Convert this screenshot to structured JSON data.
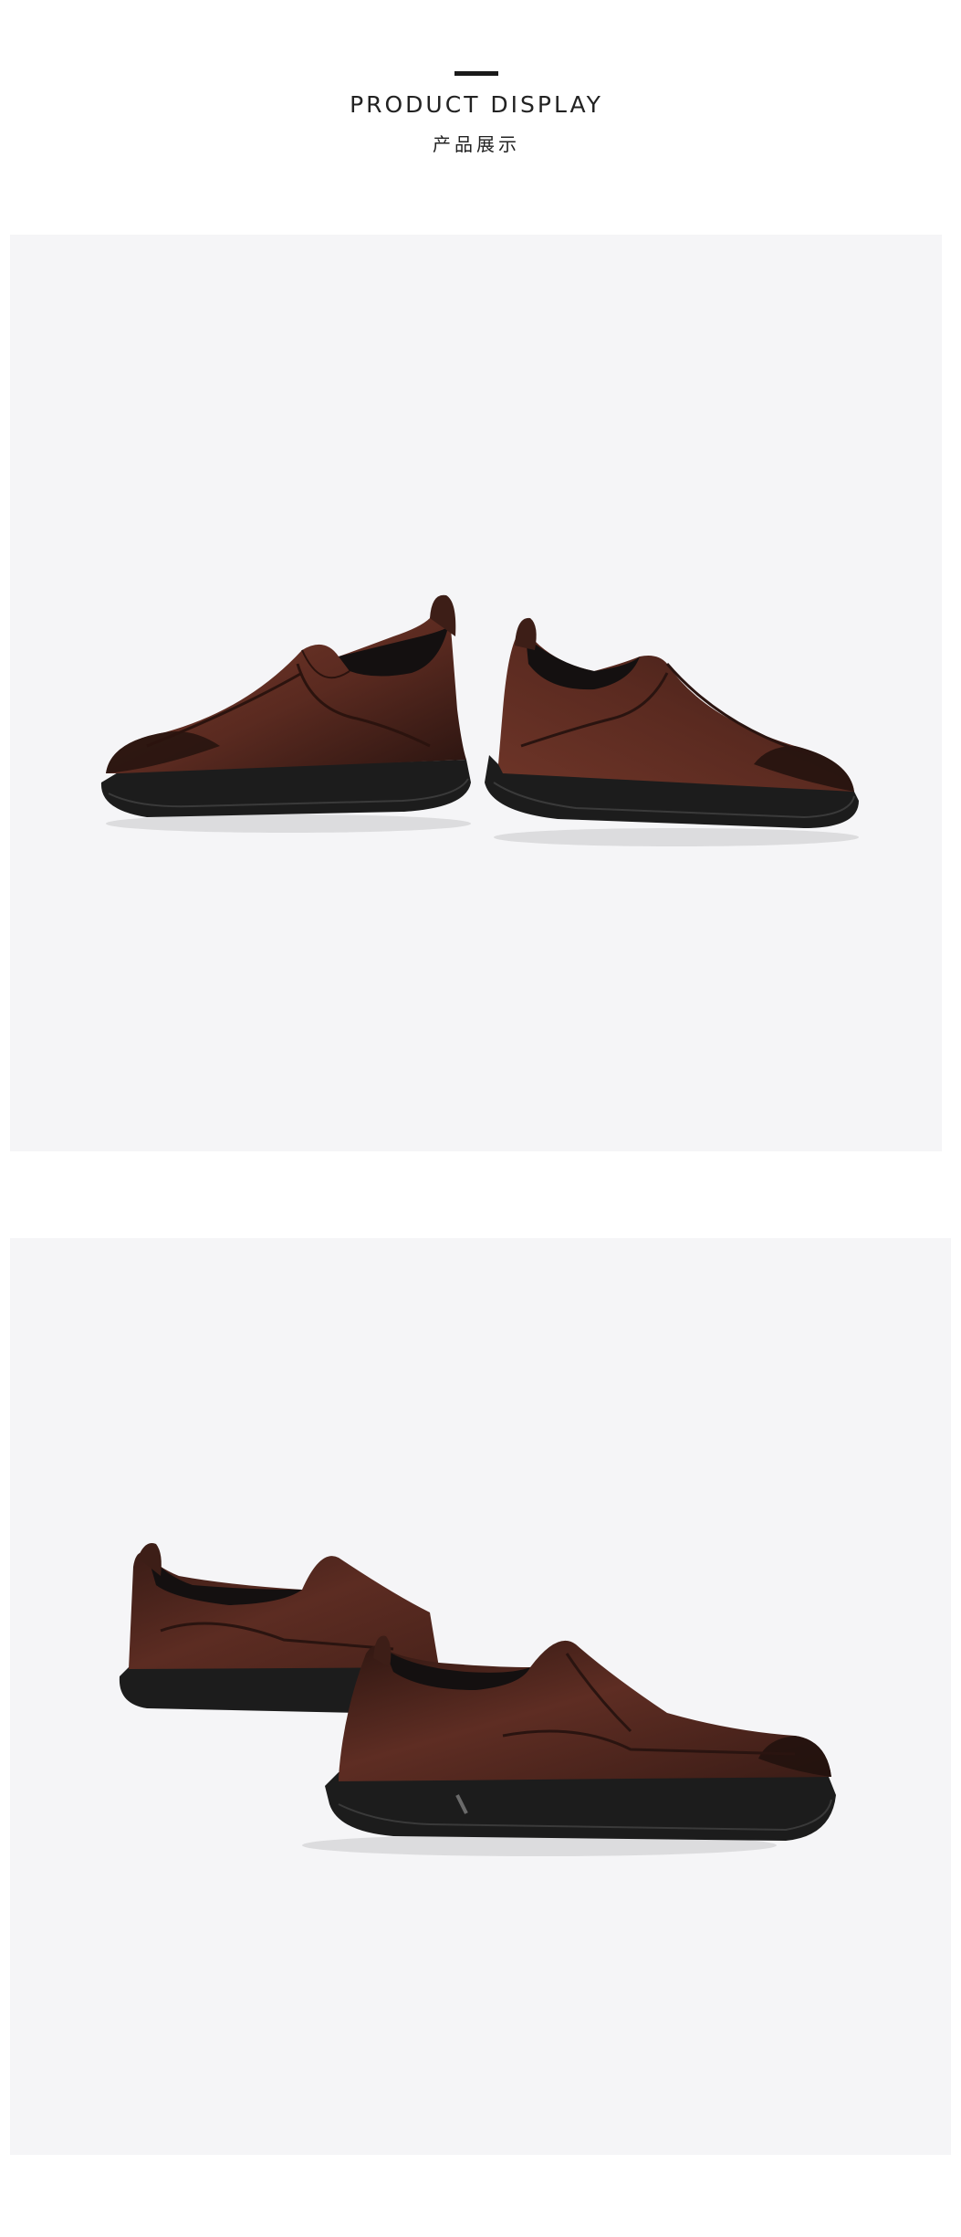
{
  "header": {
    "title": "PRODUCT DISPLAY",
    "subtitle": "产品展示"
  },
  "colors": {
    "panel_background": "#f5f5f7",
    "leather": "#5a2a20",
    "sole": "#1c1c1c"
  }
}
